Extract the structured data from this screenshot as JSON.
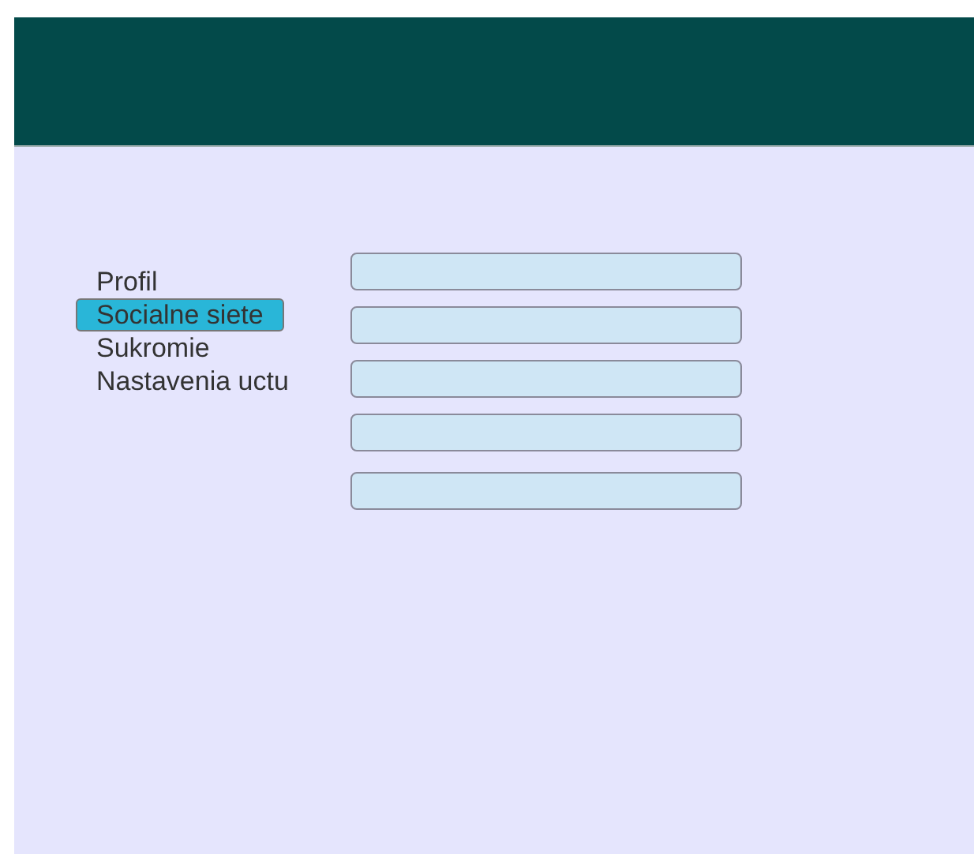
{
  "menu": [
    {
      "label": "Profil",
      "selected": false
    },
    {
      "label": "Socialne siete",
      "selected": true
    },
    {
      "label": "Sukromie",
      "selected": false
    },
    {
      "label": "Nastavenia uctu",
      "selected": false
    }
  ]
}
